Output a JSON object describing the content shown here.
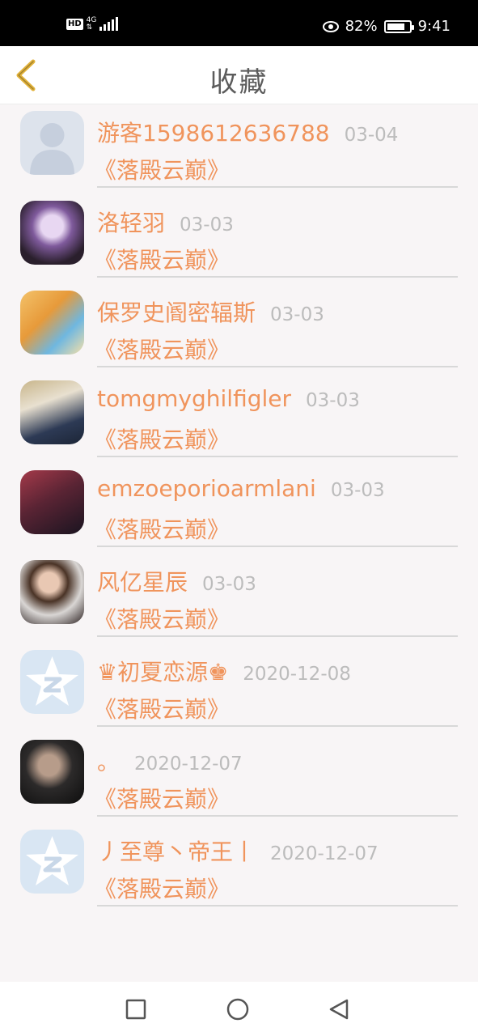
{
  "status_bar": {
    "hd": "HD",
    "network": "4G",
    "battery_percent": "82%",
    "battery_level": 0.82,
    "time": "9:41",
    "icons": [
      "signal-icon",
      "eye-icon",
      "battery-icon"
    ]
  },
  "header": {
    "title": "收藏",
    "back_icon": "chevron-left-icon"
  },
  "favorites": [
    {
      "name": "游客1598612636788",
      "date": "03-04",
      "title": "《落殿云巅》",
      "avatar": "default-user"
    },
    {
      "name": "洛轻羽",
      "date": "03-03",
      "title": "《落殿云巅》",
      "avatar": "photo"
    },
    {
      "name": "保罗史阍密辐斯",
      "date": "03-03",
      "title": "《落殿云巅》",
      "avatar": "photo"
    },
    {
      "name": "tomgmyghilfigler",
      "date": "03-03",
      "title": "《落殿云巅》",
      "avatar": "photo"
    },
    {
      "name": "emzoeporioarmlani",
      "date": "03-03",
      "title": "《落殿云巅》",
      "avatar": "photo"
    },
    {
      "name": "风亿星辰",
      "date": "03-03",
      "title": "《落殿云巅》",
      "avatar": "photo"
    },
    {
      "name": "♛初夏恋源♚",
      "date": "2020-12-08",
      "title": "《落殿云巅》",
      "avatar": "qq-default"
    },
    {
      "name": "。",
      "date": "2020-12-07",
      "title": "《落殿云巅》",
      "avatar": "photo"
    },
    {
      "name": "丿至尊丶帝王丨",
      "date": "2020-12-07",
      "title": "《落殿云巅》",
      "avatar": "qq-default"
    }
  ],
  "colors": {
    "accent": "#f0945c",
    "date": "#bcbcbc",
    "title": "#5c5c5c",
    "back_icon": "#e2b23a"
  },
  "nav_bar": {
    "icons": [
      "recent-apps-icon",
      "home-icon",
      "back-triangle-icon"
    ]
  }
}
